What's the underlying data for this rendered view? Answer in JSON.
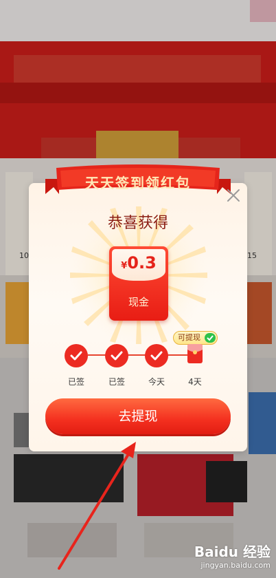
{
  "popup": {
    "ribbon_title": "天天签到领红包",
    "title": "恭喜获得",
    "amount_currency": "¥",
    "amount_value": "0.3",
    "amount_unit": "现金",
    "withdraw_badge": "可提现",
    "steps": [
      {
        "label": "已签",
        "state": "checked"
      },
      {
        "label": "已签",
        "state": "checked"
      },
      {
        "label": "今天",
        "state": "checked"
      },
      {
        "label": "4天",
        "state": "gift"
      }
    ],
    "cta_label": "去提现"
  },
  "background": {
    "left_edge_number": "10",
    "right_edge_number": "15"
  },
  "watermark": {
    "brand": "Baidu 经验",
    "url": "jingyan.baidu.com"
  },
  "colors": {
    "primary_red": "#ec2b22",
    "title_brown": "#8b1e14",
    "popup_bg": "#fff3e6",
    "wechat_green": "#2ec14b"
  }
}
